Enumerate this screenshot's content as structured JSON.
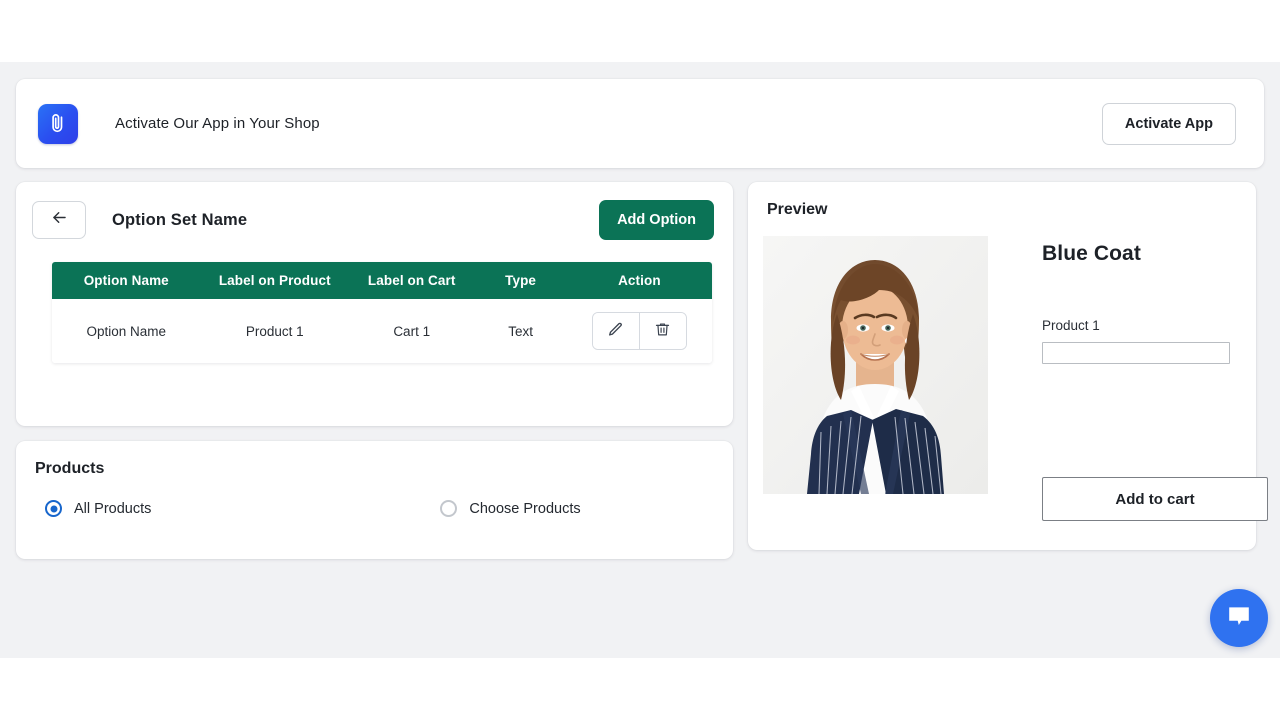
{
  "banner": {
    "logo_icon": "paperclip-app-logo-icon",
    "title": "Activate Our App in Your Shop",
    "activate_button": "Activate App"
  },
  "option_set": {
    "back_icon": "arrow-left-icon",
    "title": "Option Set Name",
    "add_option_button": "Add Option",
    "table": {
      "columns": [
        "Option Name",
        "Label on Product",
        "Label on Cart",
        "Type",
        "Action"
      ],
      "rows": [
        {
          "option_name": "Option Name",
          "label_on_product": "Product 1",
          "label_on_cart": "Cart 1",
          "type": "Text",
          "edit_icon": "pencil-icon",
          "delete_icon": "trash-icon"
        }
      ]
    }
  },
  "products": {
    "title": "Products",
    "options": [
      {
        "label": "All Products",
        "selected": true
      },
      {
        "label": "Choose Products",
        "selected": false
      }
    ]
  },
  "preview": {
    "title": "Preview",
    "image_alt": "woman-in-navy-pinstripe-blazer-portrait",
    "product_title": "Blue Coat",
    "option_label": "Product 1",
    "option_value": "",
    "option_placeholder": "",
    "add_to_cart_button": "Add to cart"
  },
  "chat_widget": {
    "icon": "chat-bubble-icon"
  },
  "colors": {
    "brand_green": "#0b7356",
    "accent_blue": "#1766cc",
    "chat_blue": "#2f72f0",
    "page_background": "#f1f2f4",
    "card_background": "#ffffff"
  }
}
